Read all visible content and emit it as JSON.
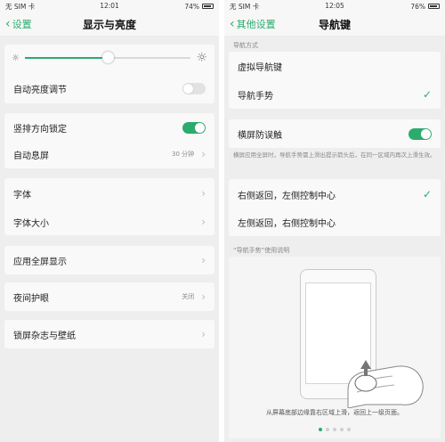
{
  "left": {
    "status": {
      "carrier": "无 SIM 卡",
      "time": "12:01",
      "battery": "74%"
    },
    "back_label": "设置",
    "title": "显示与亮度",
    "brightness_level": 0.5,
    "auto_brightness": {
      "label": "自动亮度调节",
      "on": false
    },
    "rotation_lock": {
      "label": "竖排方向锁定",
      "on": true
    },
    "auto_sleep": {
      "label": "自动息屏",
      "value": "30 分钟"
    },
    "font": {
      "label": "字体"
    },
    "font_size": {
      "label": "字体大小"
    },
    "fullscreen": {
      "label": "应用全屏显示"
    },
    "night": {
      "label": "夜间护眼",
      "value": "关闭"
    },
    "lockscreen": {
      "label": "锁屏杂志与壁纸"
    }
  },
  "right": {
    "status": {
      "carrier": "无 SIM 卡",
      "time": "12:05",
      "battery": "76%"
    },
    "back_label": "其他设置",
    "title": "导航键",
    "section_mode": "导航方式",
    "virtual_keys": {
      "label": "虚拟导航键"
    },
    "gesture": {
      "label": "导航手势",
      "checked": true
    },
    "anti_mistouch": {
      "label": "横屏防误触",
      "on": true
    },
    "anti_desc": "横屏应用全屏时，导航手势需上滑出提示箭头后，在同一区域内再次上滑生效。",
    "option_a": {
      "label": "右侧返回，左侧控制中心",
      "checked": true
    },
    "option_b": {
      "label": "左侧返回，右侧控制中心",
      "checked": false
    },
    "guide_label": "“导航手势”使用说明",
    "guide_caption": "从屏幕底部边缘靠右区域上滑，返回上一级页面。",
    "page_count": 5,
    "page_active": 0
  },
  "colors": {
    "accent": "#2bab6d"
  }
}
